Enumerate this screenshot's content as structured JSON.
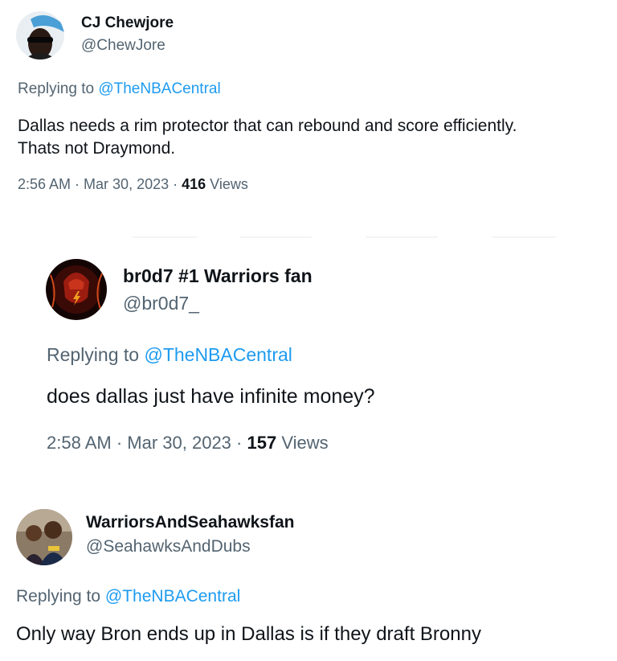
{
  "tweets": [
    {
      "display_name": "CJ Chewjore",
      "handle": "@ChewJore",
      "replying_prefix": "Replying to ",
      "replying_to": "@TheNBACentral",
      "text": "Dallas needs a rim protector that can rebound and score efficiently.\nThats not Draymond.",
      "time": "2:56 AM",
      "separator": " · ",
      "date": "Mar 30, 2023",
      "views_count": "416",
      "views_label": " Views"
    },
    {
      "display_name": "br0d7 #1 Warriors fan",
      "handle": "@br0d7_",
      "replying_prefix": "Replying to ",
      "replying_to": "@TheNBACentral",
      "text": "does dallas just have infinite money?",
      "time": "2:58 AM",
      "separator": " · ",
      "date": "Mar 30, 2023",
      "views_count": "157",
      "views_label": " Views"
    },
    {
      "display_name": "WarriorsAndSeahawksfan",
      "handle": "@SeahawksAndDubs",
      "replying_prefix": "Replying to ",
      "replying_to": "@TheNBACentral",
      "text": "Only way Bron ends up in Dallas is if they draft Bronny"
    }
  ],
  "colors": {
    "text": "#0f1419",
    "secondary": "#536471",
    "link": "#1d9bf0"
  },
  "icons": {
    "avatar_1": "profile-photo-sunglasses",
    "avatar_2": "profile-photo-flash",
    "avatar_3": "profile-photo-two-people"
  }
}
